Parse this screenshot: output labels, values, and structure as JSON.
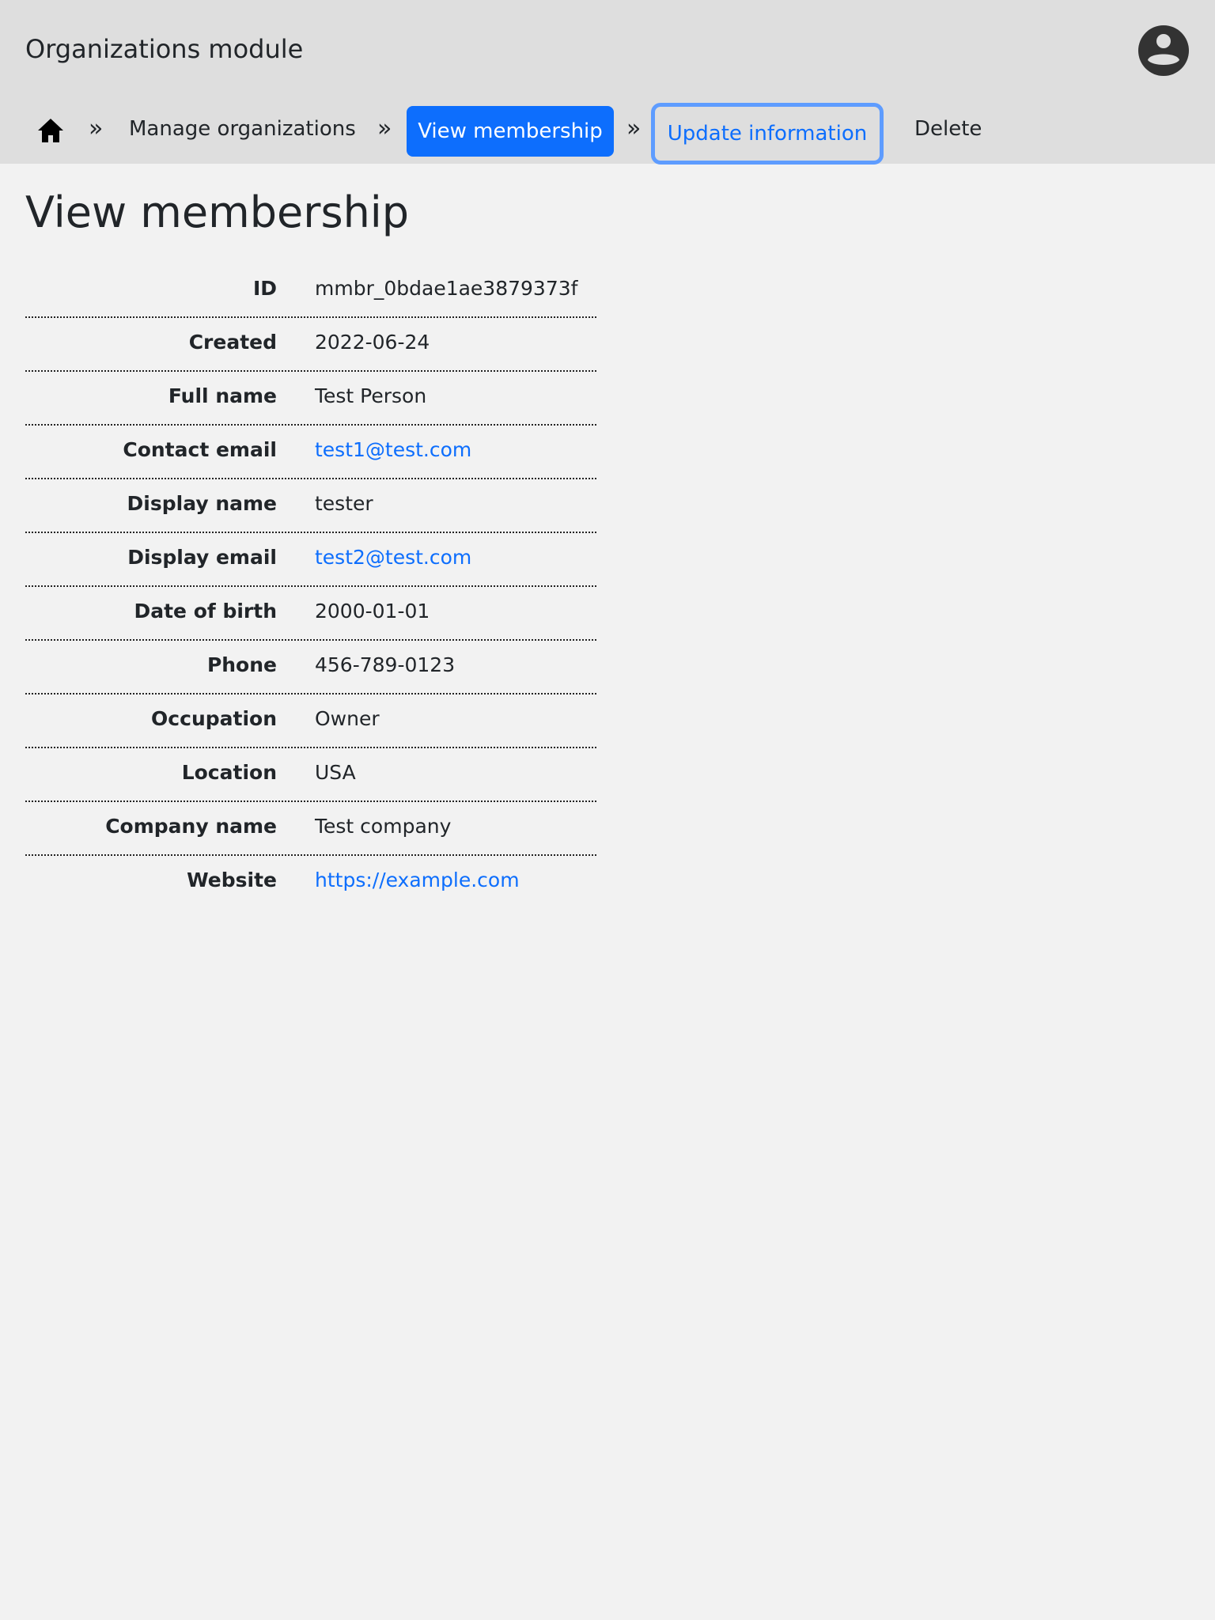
{
  "header": {
    "app_title": "Organizations module",
    "avatar_icon": "user-circle-icon"
  },
  "breadcrumb": {
    "home_icon": "home-icon",
    "separator": "»",
    "items": [
      {
        "label": "Manage organizations",
        "state": "default"
      },
      {
        "label": "View membership",
        "state": "active"
      },
      {
        "label": "Update information",
        "state": "focused"
      },
      {
        "label": "Delete",
        "state": "default"
      }
    ]
  },
  "page": {
    "title": "View membership"
  },
  "details": [
    {
      "label": "ID",
      "value": "mmbr_0bdae1ae3879373f",
      "link": false
    },
    {
      "label": "Created",
      "value": "2022-06-24",
      "link": false
    },
    {
      "label": "Full name",
      "value": "Test Person",
      "link": false
    },
    {
      "label": "Contact email",
      "value": "test1@test.com",
      "link": true
    },
    {
      "label": "Display name",
      "value": "tester",
      "link": false
    },
    {
      "label": "Display email",
      "value": "test2@test.com",
      "link": true
    },
    {
      "label": "Date of birth",
      "value": "2000-01-01",
      "link": false
    },
    {
      "label": "Phone",
      "value": "456-789-0123",
      "link": false
    },
    {
      "label": "Occupation",
      "value": "Owner",
      "link": false
    },
    {
      "label": "Location",
      "value": "USA",
      "link": false
    },
    {
      "label": "Company name",
      "value": "Test company",
      "link": false
    },
    {
      "label": "Website",
      "value": "https://example.com",
      "link": true
    }
  ],
  "colors": {
    "header_bg": "#dedede",
    "page_bg": "#f2f2f2",
    "primary": "#0d6efd",
    "focus_ring": "#5e9cff",
    "text": "#212529"
  }
}
